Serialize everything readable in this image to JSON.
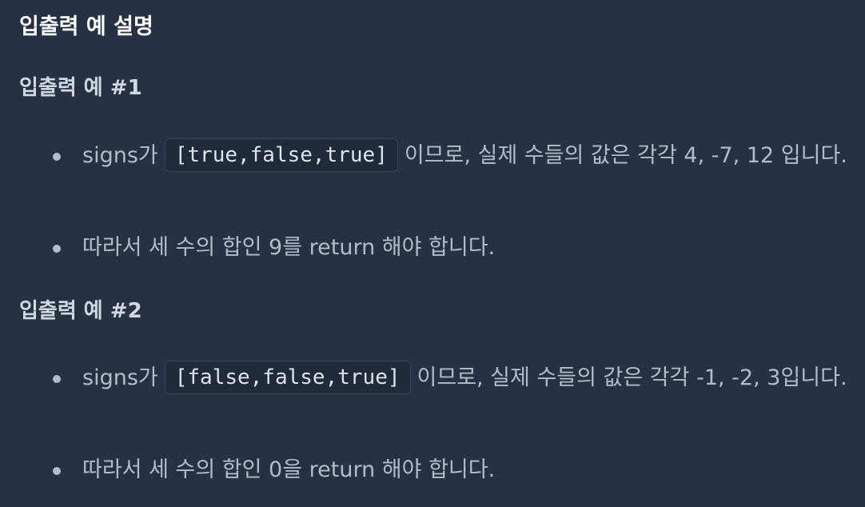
{
  "heading": "입출력 예 설명",
  "examples": [
    {
      "title": "입출력 예 #1",
      "items": [
        {
          "prefix": "signs가",
          "code": "[true,false,true]",
          "suffix": "이므로, 실제 수들의 값은 각각 4, -7, 12 입니다."
        },
        {
          "text": "따라서 세 수의 합인 9를 return 해야 합니다."
        }
      ]
    },
    {
      "title": "입출력 예 #2",
      "items": [
        {
          "prefix": "signs가",
          "code": "[false,false,true]",
          "suffix": "이므로, 실제 수들의 값은 각각 -1, -2, 3입니다."
        },
        {
          "text": "따라서 세 수의 합인 0을 return 해야 합니다."
        }
      ]
    }
  ]
}
